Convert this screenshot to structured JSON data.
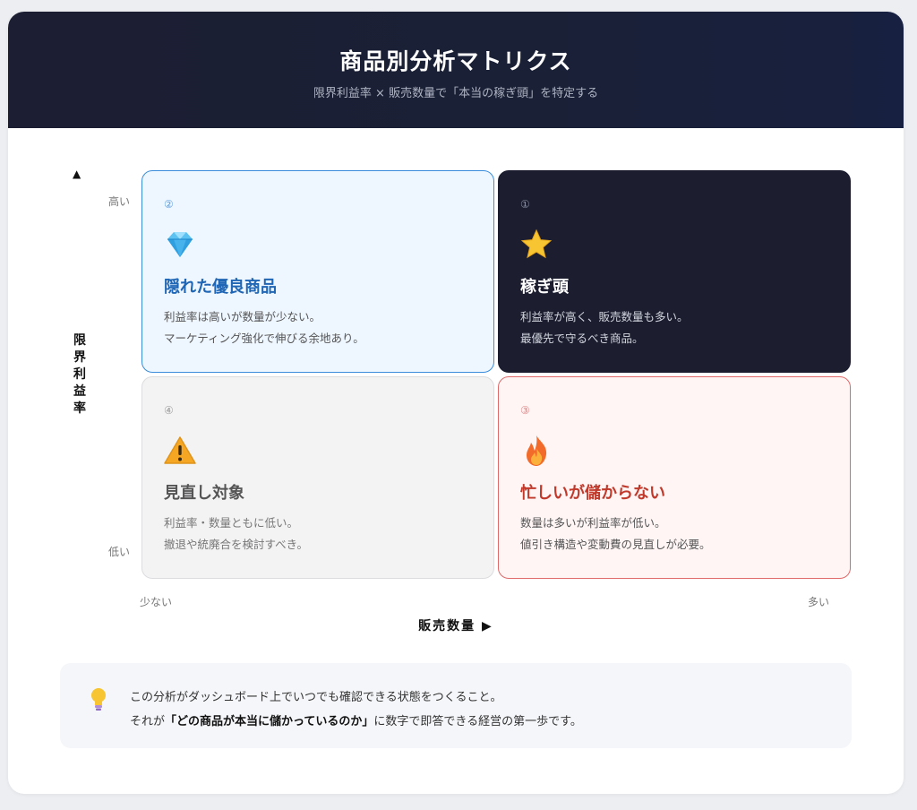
{
  "header": {
    "title": "商品別分析マトリクス",
    "subtitle": "限界利益率 × 販売数量で「本当の稼ぎ頭」を特定する"
  },
  "axes": {
    "y_arrow": "▲",
    "y_title": [
      "限",
      "界",
      "利",
      "益",
      "率"
    ],
    "y_high": "高い",
    "y_low": "低い",
    "x_low": "少ない",
    "x_high": "多い",
    "x_title": "販売数量 ▶"
  },
  "quadrants": [
    {
      "number": "②",
      "icon": "diamond-icon",
      "title": "隠れた優良商品",
      "desc_line1": "利益率は高いが数量が少ない。",
      "desc_line2": "マーケティング強化で伸びる余地あり。",
      "accent": "#3b8ddb"
    },
    {
      "number": "①",
      "icon": "star-icon",
      "title": "稼ぎ頭",
      "desc_line1": "利益率が高く、販売数量も多い。",
      "desc_line2": "最優先で守るべき商品。",
      "accent": "#1c1e30"
    },
    {
      "number": "④",
      "icon": "warning-icon",
      "title": "見直し対象",
      "desc_line1": "利益率・数量ともに低い。",
      "desc_line2": "撤退や統廃合を検討すべき。",
      "accent": "#dcdcdf"
    },
    {
      "number": "③",
      "icon": "fire-icon",
      "title": "忙しいが儲からない",
      "desc_line1": "数量は多いが利益率が低い。",
      "desc_line2": "値引き構造や変動費の見直しが必要。",
      "accent": "#e06a6a"
    }
  ],
  "callout": {
    "icon": "lightbulb-icon",
    "line1": "この分析がダッシュボード上でいつでも確認できる状態をつくること。",
    "line2_prefix": "それが",
    "line2_bold": "「どの商品が本当に儲かっているのか」",
    "line2_suffix": "に数字で即答できる経営の第一歩です。"
  }
}
